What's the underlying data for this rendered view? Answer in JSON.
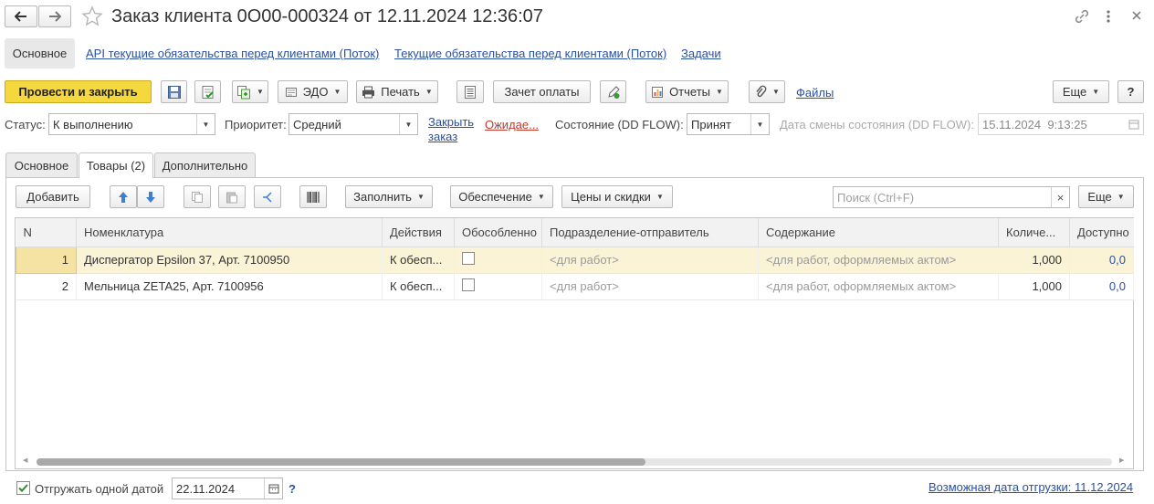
{
  "window": {
    "title": "Заказ клиента 0О00-000324 от 12.11.2024 12:36:07"
  },
  "nav": {
    "items": [
      {
        "label": "Основное"
      },
      {
        "label": "API текущие обязательства перед клиентами (Поток)"
      },
      {
        "label": "Текущие обязательства перед клиентами (Поток)"
      },
      {
        "label": "Задачи"
      }
    ]
  },
  "toolbar": {
    "post_close": "Провести и закрыть",
    "edo": "ЭДО",
    "print": "Печать",
    "payment_offset": "Зачет оплаты",
    "reports": "Отчеты",
    "files": "Файлы",
    "more": "Еще",
    "help": "?"
  },
  "header_fields": {
    "status_label": "Статус:",
    "status_value": "К выполнению",
    "priority_label": "Приоритет:",
    "priority_value": "Средний",
    "close_order_link_1": "Закрыть",
    "close_order_link_2": "заказ",
    "waiting_link": "Ожидае...",
    "state_label": "Состояние (DD FLOW):",
    "state_value": "Принят",
    "state_date_label": "Дата смены состояния (DD FLOW):",
    "state_date_value": "15.11.2024  9:13:25"
  },
  "tabs": [
    {
      "label": "Основное"
    },
    {
      "label": "Товары (2)"
    },
    {
      "label": "Дополнительно"
    }
  ],
  "goods_toolbar": {
    "add": "Добавить",
    "fill": "Заполнить",
    "supply": "Обеспечение",
    "prices": "Цены и скидки",
    "search_placeholder": "Поиск (Ctrl+F)",
    "more": "Еще"
  },
  "table": {
    "columns": [
      "N",
      "Номенклатура",
      "Действия",
      "Обособленно",
      "Подразделение-отправитель",
      "Содержание",
      "Количе...",
      "Доступно"
    ],
    "rows": [
      {
        "n": "1",
        "item": "Диспергатор Epsilon 37, Арт. 7100950",
        "action": "К обесп...",
        "separate": false,
        "dept": "<для работ>",
        "content": "<для работ, оформляемых актом>",
        "qty": "1,000",
        "avail": "0,0"
      },
      {
        "n": "2",
        "item": "Мельница ZETA25, Арт. 7100956",
        "action": "К обесп...",
        "separate": false,
        "dept": "<для работ>",
        "content": "<для работ, оформляемых актом>",
        "qty": "1,000",
        "avail": "0,0"
      }
    ]
  },
  "footer": {
    "ship_one_date_label": "Отгружать одной датой",
    "ship_one_date_checked": true,
    "ship_date": "22.11.2024",
    "help": "?",
    "possible_date_link": "Возможная дата отгрузки: 11.12.2024"
  },
  "colors": {
    "primary_button": "#f5d73e",
    "selected_row": "#faf3d5",
    "link": "#2a50a0",
    "warning_link": "#c0392b"
  }
}
